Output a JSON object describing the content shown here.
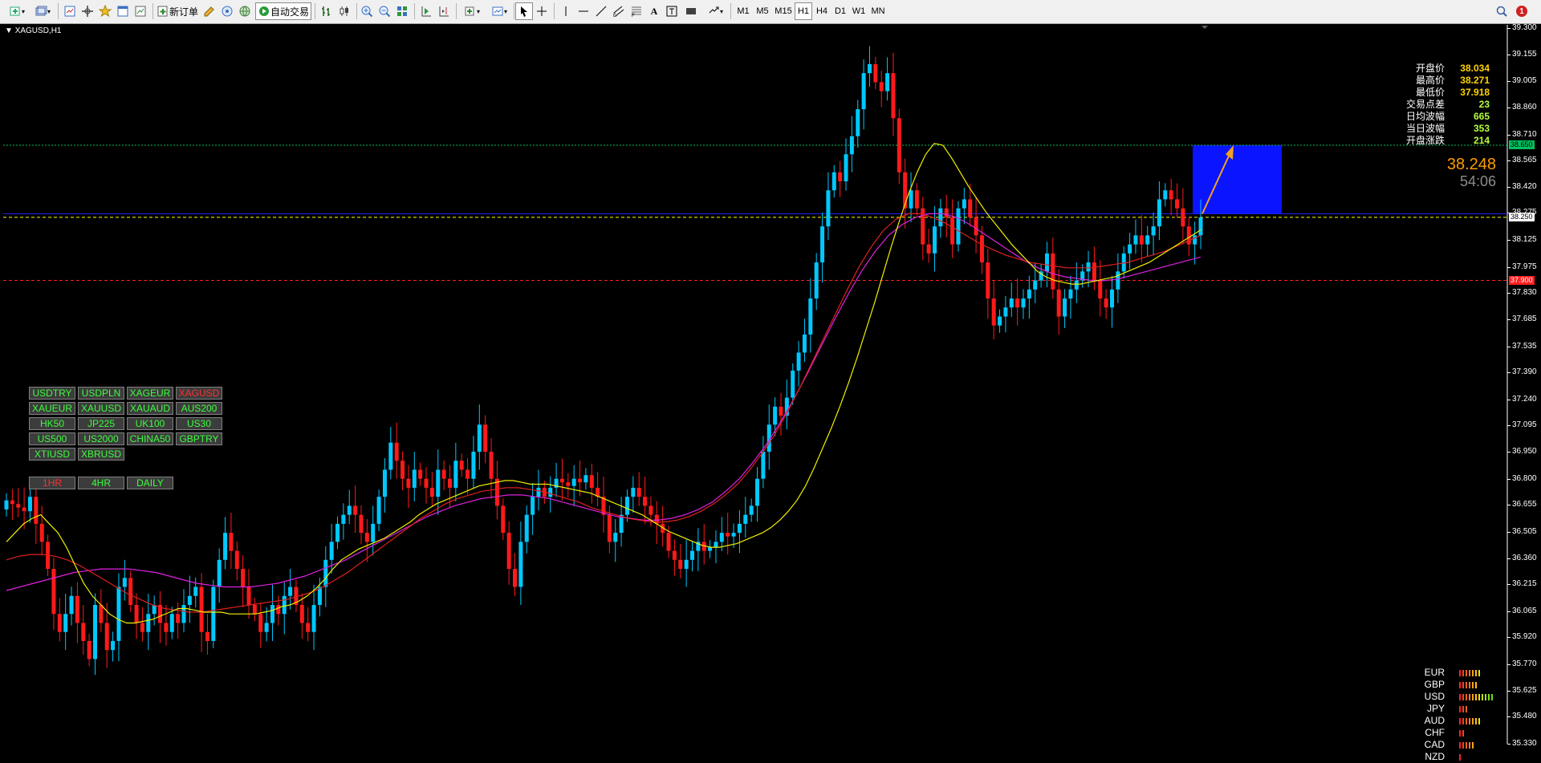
{
  "window": {
    "symbol": "XAGUSD,H1"
  },
  "toolbar": {
    "new_order_label": "新订单",
    "auto_trading_label": "自动交易",
    "timeframes": [
      "M1",
      "M5",
      "M15",
      "H1",
      "H4",
      "D1",
      "W1",
      "MN"
    ],
    "active_timeframe": "H1",
    "notification_count": "1"
  },
  "info_panel": {
    "rows": [
      {
        "label": "开盘价",
        "value": "38.034"
      },
      {
        "label": "最高价",
        "value": "38.271"
      },
      {
        "label": "最低价",
        "value": "37.918"
      },
      {
        "label": "交易点差",
        "value": "23"
      },
      {
        "label": "日均波幅",
        "value": "665"
      },
      {
        "label": "当日波幅",
        "value": "353"
      },
      {
        "label": "开盘涨跌",
        "value": "214"
      }
    ],
    "bid": "38.248",
    "timer": "54:06"
  },
  "symbol_buttons": [
    {
      "label": "USDTRY"
    },
    {
      "label": "USDPLN"
    },
    {
      "label": "XAGEUR"
    },
    {
      "label": "XAGUSD",
      "current": true
    },
    {
      "label": "XAUEUR"
    },
    {
      "label": "XAUUSD"
    },
    {
      "label": "XAUAUD"
    },
    {
      "label": "AUS200"
    },
    {
      "label": "HK50"
    },
    {
      "label": "JP225"
    },
    {
      "label": "UK100"
    },
    {
      "label": "US30"
    },
    {
      "label": "US500"
    },
    {
      "label": "US2000"
    },
    {
      "label": "CHINA50"
    },
    {
      "label": "GBPTRY"
    },
    {
      "label": "XTIUSD"
    },
    {
      "label": "XBRUSD"
    }
  ],
  "timeframe_buttons": [
    {
      "label": "1HR",
      "current": true
    },
    {
      "label": "4HR"
    },
    {
      "label": "DAILY"
    }
  ],
  "currency_strength": [
    {
      "name": "EUR",
      "bars": 7
    },
    {
      "name": "GBP",
      "bars": 6
    },
    {
      "name": "USD",
      "bars": 11
    },
    {
      "name": "JPY",
      "bars": 3
    },
    {
      "name": "AUD",
      "bars": 7
    },
    {
      "name": "CHF",
      "bars": 2
    },
    {
      "name": "CAD",
      "bars": 5
    },
    {
      "name": "NZD",
      "bars": 1
    }
  ],
  "price_axis": {
    "ticks": [
      "39.300",
      "39.155",
      "39.005",
      "38.860",
      "38.710",
      "38.565",
      "38.420",
      "38.275",
      "38.125",
      "37.975",
      "37.830",
      "37.685",
      "37.535",
      "37.390",
      "37.240",
      "37.095",
      "36.950",
      "36.800",
      "36.655",
      "36.505",
      "36.360",
      "36.215",
      "36.065",
      "35.920",
      "35.770",
      "35.625",
      "35.480",
      "35.330"
    ],
    "tag_top": "38.650",
    "tag_bid": "38.250",
    "tag_red": "37.900"
  },
  "chart_data": {
    "type": "candlestick",
    "symbol": "XAGUSD",
    "timeframe": "H1",
    "ylim": [
      35.33,
      39.3
    ],
    "levels": [
      {
        "price": 38.65,
        "color": "#00c060",
        "style": "dotted"
      },
      {
        "price": 38.27,
        "color": "#2020ff",
        "style": "solid"
      },
      {
        "price": 38.25,
        "color": "#ffff00",
        "style": "dashed"
      },
      {
        "price": 37.9,
        "color": "#ff2020",
        "style": "dashed"
      }
    ],
    "box": {
      "from_price": 38.27,
      "to_price": 38.65,
      "color": "#0a14ff"
    },
    "closes": [
      36.68,
      36.66,
      36.64,
      36.62,
      36.7,
      36.55,
      36.45,
      36.3,
      36.05,
      35.95,
      36.05,
      36.15,
      36.0,
      35.9,
      35.8,
      36.1,
      36.0,
      35.85,
      35.9,
      36.2,
      36.25,
      36.1,
      36.0,
      35.95,
      36.05,
      36.1,
      36.0,
      35.95,
      36.05,
      36.0,
      36.1,
      36.15,
      36.2,
      35.95,
      35.9,
      36.2,
      36.35,
      36.5,
      36.4,
      36.3,
      36.2,
      36.1,
      36.05,
      35.95,
      36.0,
      36.1,
      36.05,
      36.15,
      36.2,
      36.1,
      36.0,
      35.95,
      36.1,
      36.2,
      36.35,
      36.45,
      36.55,
      36.6,
      36.65,
      36.6,
      36.5,
      36.45,
      36.55,
      36.7,
      36.85,
      37.0,
      36.9,
      36.8,
      36.75,
      36.85,
      36.8,
      36.75,
      36.7,
      36.85,
      36.8,
      36.75,
      36.9,
      36.85,
      36.8,
      36.95,
      37.1,
      36.95,
      36.8,
      36.65,
      36.5,
      36.3,
      36.2,
      36.45,
      36.6,
      36.7,
      36.75,
      36.7,
      36.75,
      36.8,
      36.78,
      36.76,
      36.8,
      36.78,
      36.82,
      36.75,
      36.7,
      36.6,
      36.45,
      36.5,
      36.6,
      36.7,
      36.75,
      36.7,
      36.65,
      36.6,
      36.55,
      36.5,
      36.4,
      36.35,
      36.3,
      36.35,
      36.4,
      36.45,
      36.4,
      36.42,
      36.45,
      36.5,
      36.48,
      36.5,
      36.55,
      36.6,
      36.65,
      36.8,
      36.95,
      37.1,
      37.2,
      37.15,
      37.25,
      37.4,
      37.5,
      37.6,
      37.8,
      38.0,
      38.2,
      38.4,
      38.5,
      38.45,
      38.6,
      38.7,
      38.85,
      39.05,
      39.1,
      39.0,
      38.95,
      39.05,
      38.8,
      38.5,
      38.3,
      38.4,
      38.3,
      38.1,
      38.05,
      38.2,
      38.3,
      38.25,
      38.1,
      38.3,
      38.35,
      38.25,
      38.15,
      38.0,
      37.8,
      37.65,
      37.7,
      37.75,
      37.8,
      37.75,
      37.8,
      37.85,
      37.9,
      37.95,
      38.05,
      37.85,
      37.7,
      37.8,
      37.85,
      37.9,
      37.95,
      38.0,
      37.9,
      37.8,
      37.75,
      37.85,
      37.95,
      38.05,
      38.1,
      38.15,
      38.1,
      38.15,
      38.2,
      38.35,
      38.4,
      38.35,
      38.3,
      38.2,
      38.1,
      38.15,
      38.25
    ],
    "ma_fast": [
      36.45,
      36.5,
      36.55,
      36.58,
      36.6,
      36.55,
      36.5,
      36.42,
      36.32,
      36.22,
      36.15,
      36.1,
      36.05,
      36.02,
      36.0,
      36.0,
      36.01,
      36.02,
      36.04,
      36.06,
      36.08,
      36.08,
      36.07,
      36.06,
      36.06,
      36.06,
      36.05,
      36.05,
      36.05,
      36.05,
      36.06,
      36.07,
      36.09,
      36.1,
      36.12,
      36.15,
      36.19,
      36.24,
      36.3,
      36.35,
      36.38,
      36.41,
      36.43,
      36.45,
      36.47,
      36.5,
      36.53,
      36.56,
      36.6,
      36.63,
      36.66,
      36.68,
      36.7,
      36.72,
      36.74,
      36.76,
      36.77,
      36.78,
      36.79,
      36.79,
      36.78,
      36.77,
      36.77,
      36.77,
      36.76,
      36.75,
      36.74,
      36.73,
      36.72,
      36.7,
      36.68,
      36.66,
      36.64,
      36.62,
      36.6,
      36.57,
      36.54,
      36.51,
      36.49,
      36.47,
      36.45,
      36.43,
      36.42,
      36.42,
      36.43,
      36.44,
      36.46,
      36.48,
      36.5,
      36.53,
      36.57,
      36.62,
      36.68,
      36.76,
      36.86,
      36.97,
      37.08,
      37.2,
      37.33,
      37.47,
      37.62,
      37.77,
      37.93,
      38.09,
      38.24,
      38.38,
      38.5,
      38.6,
      38.66,
      38.65,
      38.58,
      38.5,
      38.42,
      38.35,
      38.28,
      38.22,
      38.16,
      38.1,
      38.05,
      38.0,
      37.95,
      37.92,
      37.9,
      37.89,
      37.88,
      37.88,
      37.89,
      37.9,
      37.91,
      37.92,
      37.94,
      37.96,
      37.98,
      38.0,
      38.03,
      38.06,
      38.09,
      38.12,
      38.15,
      38.18
    ],
    "ma_mid": [
      36.35,
      36.37,
      36.38,
      36.38,
      36.37,
      36.35,
      36.32,
      36.28,
      36.24,
      36.2,
      36.16,
      36.13,
      36.1,
      36.08,
      36.07,
      36.06,
      36.06,
      36.07,
      36.08,
      36.09,
      36.1,
      36.11,
      36.12,
      36.13,
      36.15,
      36.17,
      36.2,
      36.24,
      36.28,
      36.33,
      36.38,
      36.43,
      36.48,
      36.53,
      36.58,
      36.62,
      36.66,
      36.69,
      36.71,
      36.73,
      36.74,
      36.75,
      36.75,
      36.74,
      36.73,
      36.71,
      36.69,
      36.67,
      36.64,
      36.62,
      36.6,
      36.58,
      36.57,
      36.56,
      36.56,
      36.57,
      36.59,
      36.62,
      36.66,
      36.71,
      36.77,
      36.85,
      36.94,
      37.04,
      37.16,
      37.29,
      37.43,
      37.57,
      37.71,
      37.85,
      37.98,
      38.09,
      38.18,
      38.24,
      38.27,
      38.27,
      38.25,
      38.22,
      38.18,
      38.14,
      38.1,
      38.07,
      38.04,
      38.02,
      38.0,
      37.99,
      37.98,
      37.97,
      37.97,
      37.97,
      37.98,
      37.99,
      38.0,
      38.02,
      38.04,
      38.06,
      38.09,
      38.12,
      38.15
    ],
    "ma_slow": [
      36.18,
      36.2,
      36.22,
      36.24,
      36.26,
      36.28,
      36.29,
      36.3,
      36.3,
      36.3,
      36.29,
      36.28,
      36.26,
      36.24,
      36.22,
      36.21,
      36.2,
      36.2,
      36.2,
      36.21,
      36.22,
      36.24,
      36.26,
      36.29,
      36.32,
      36.35,
      36.39,
      36.43,
      36.47,
      36.51,
      36.55,
      36.59,
      36.62,
      36.65,
      36.67,
      36.69,
      36.7,
      36.71,
      36.71,
      36.7,
      36.69,
      36.67,
      36.65,
      36.63,
      36.61,
      36.59,
      36.58,
      36.57,
      36.57,
      36.58,
      36.6,
      36.63,
      36.67,
      36.73,
      36.8,
      36.89,
      36.99,
      37.11,
      37.24,
      37.38,
      37.53,
      37.68,
      37.82,
      37.95,
      38.06,
      38.15,
      38.21,
      38.25,
      38.27,
      38.27,
      38.25,
      38.21,
      38.16,
      38.11,
      38.06,
      38.01,
      37.97,
      37.94,
      37.92,
      37.91,
      37.9,
      37.9,
      37.91,
      37.93,
      37.95,
      37.97,
      37.99,
      38.01,
      38.03
    ]
  }
}
